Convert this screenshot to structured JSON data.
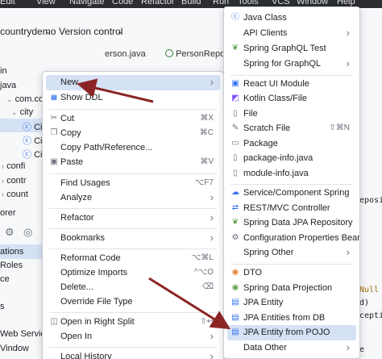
{
  "menubar": {
    "items": [
      "Edit",
      "View",
      "Navigate",
      "Code",
      "Refactor",
      "Build",
      "Run",
      "Tools",
      "VCS",
      "Window",
      "Help"
    ]
  },
  "toolbar": {
    "project": "countrydemo",
    "vcs": "Version control"
  },
  "editor_tabs": [
    "erson.java",
    "PersonRepos"
  ],
  "tree": {
    "items": [
      "in",
      "java",
      "com.com",
      "city",
      "Ci",
      "Ci",
      "Ci",
      "confi",
      "contr",
      "count",
      "orer",
      "ations",
      "Roles",
      "ce",
      "s",
      "Web Service",
      "Vindow"
    ]
  },
  "code_fragments": [
    "eposi",
    "Null",
    "d)",
    "cepti",
    "e"
  ],
  "context_menu": {
    "items": [
      {
        "label": "New",
        "arrow": true,
        "selected": true
      },
      {
        "label": "Show DDL",
        "icon": "ddl-icon"
      },
      {
        "label": "Cut",
        "shortcut": "⌘X",
        "icon": "scissors-icon"
      },
      {
        "label": "Copy",
        "shortcut": "⌘C",
        "icon": "copy-icon"
      },
      {
        "label": "Copy Path/Reference..."
      },
      {
        "label": "Paste",
        "shortcut": "⌘V",
        "icon": "paste-icon"
      },
      {
        "label": "Find Usages",
        "shortcut": "⌥F7"
      },
      {
        "label": "Analyze",
        "arrow": true
      },
      {
        "label": "Refactor",
        "arrow": true
      },
      {
        "label": "Bookmarks",
        "arrow": true
      },
      {
        "label": "Reformat Code",
        "shortcut": "⌥⌘L"
      },
      {
        "label": "Optimize Imports",
        "shortcut": "^⌥O"
      },
      {
        "label": "Delete...",
        "shortcut": "⌫"
      },
      {
        "label": "Override File Type"
      },
      {
        "label": "Open in Right Split",
        "shortcut": "⇧↩",
        "icon": "split-icon"
      },
      {
        "label": "Open In",
        "arrow": true
      },
      {
        "label": "Local History",
        "arrow": true
      }
    ]
  },
  "submenu": {
    "items": [
      {
        "label": "Java Class",
        "icon": "java-class-icon"
      },
      {
        "label": "API Clients",
        "arrow": true
      },
      {
        "label": "Spring GraphQL Test",
        "icon": "spring-icon"
      },
      {
        "label": "Spring for GraphQL",
        "arrow": true
      },
      {
        "label": "React UI Module",
        "icon": "react-icon"
      },
      {
        "label": "Kotlin Class/File",
        "icon": "kotlin-icon"
      },
      {
        "label": "File",
        "icon": "file-icon"
      },
      {
        "label": "Scratch File",
        "shortcut": "⇧⌘N",
        "icon": "scratch-file-icon"
      },
      {
        "label": "Package",
        "icon": "package-icon"
      },
      {
        "label": "package-info.java",
        "icon": "package-info-icon"
      },
      {
        "label": "module-info.java",
        "icon": "module-info-icon"
      },
      {
        "label": "Service/Component Spring",
        "icon": "spring-component-icon"
      },
      {
        "label": "REST/MVC Controller",
        "icon": "rest-controller-icon"
      },
      {
        "label": "Spring Data JPA Repository",
        "icon": "spring-data-icon"
      },
      {
        "label": "Configuration Properties Bean",
        "icon": "gear-icon"
      },
      {
        "label": "Spring Other",
        "arrow": true
      },
      {
        "label": "DTO",
        "icon": "dto-icon"
      },
      {
        "label": "Spring Data Projection",
        "icon": "projection-icon"
      },
      {
        "label": "JPA Entity",
        "icon": "jpa-entity-icon"
      },
      {
        "label": "JPA Entities from DB",
        "icon": "jpa-db-icon"
      },
      {
        "label": "JPA Entity from POJO",
        "icon": "jpa-pojo-icon",
        "selected": true
      },
      {
        "label": "Data Other",
        "arrow": true
      }
    ]
  },
  "colors": {
    "selection": "#d5e1f5",
    "annotation_arrow": "#8b2525",
    "spring_green": "#5fa04e",
    "java_blue": "#3574f0"
  }
}
